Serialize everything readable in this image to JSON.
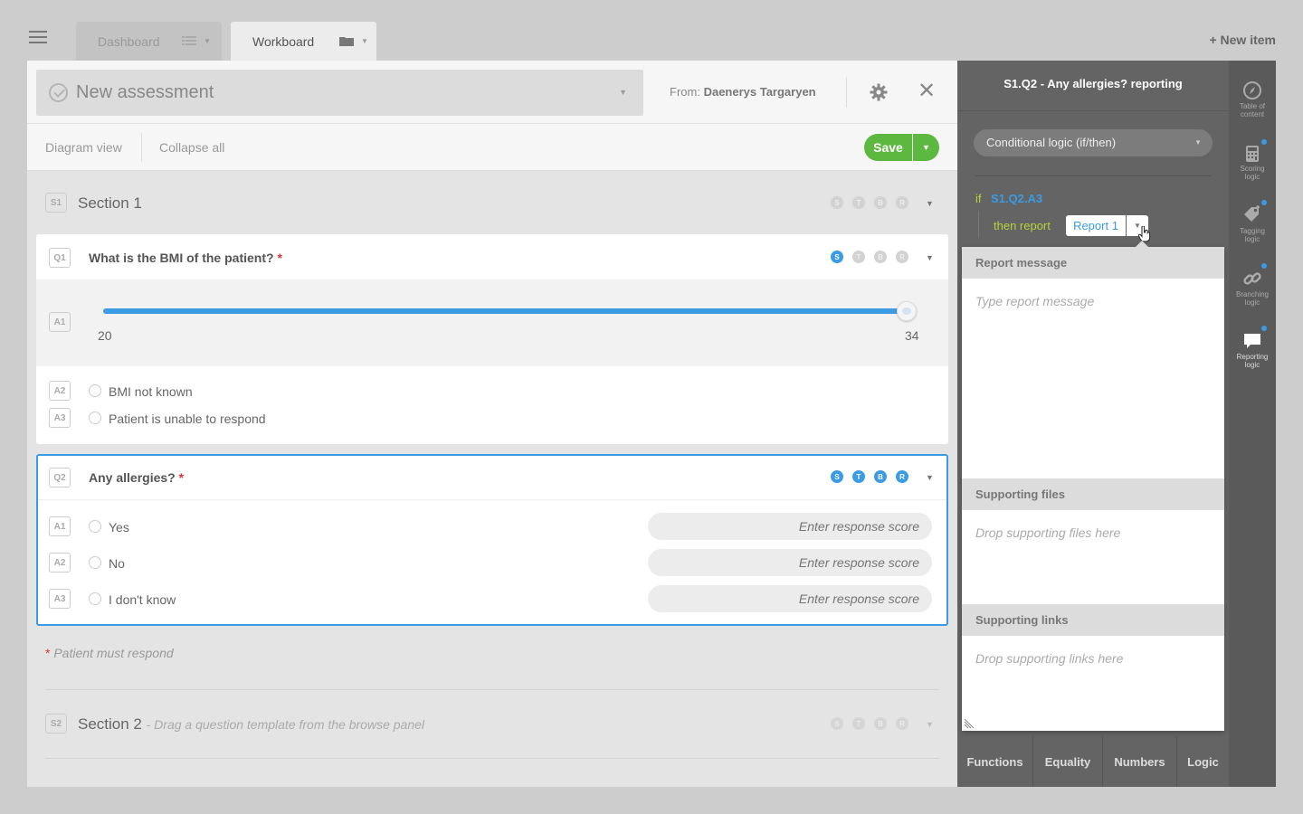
{
  "topbar": {
    "tabs": [
      {
        "label": "Dashboard"
      },
      {
        "label": "Workboard"
      }
    ],
    "new_item": "+ New item"
  },
  "header": {
    "title": "New assessment",
    "from_label": "From:",
    "from_name": "Daenerys Targaryen"
  },
  "toolbar": {
    "diagram_view": "Diagram view",
    "collapse_all": "Collapse all",
    "save": "Save"
  },
  "flags": [
    "S",
    "T",
    "B",
    "R"
  ],
  "section1": {
    "badge": "S1",
    "title": "Section 1"
  },
  "q1": {
    "badge": "Q1",
    "title": "What is the BMI of the patient?",
    "required_mark": "*",
    "slider": {
      "badge": "A1",
      "min_label": "20",
      "max_label": "34",
      "value_fraction": 1.0
    },
    "answers": [
      {
        "badge": "A2",
        "text": "BMI not known"
      },
      {
        "badge": "A3",
        "text": "Patient is unable to respond"
      }
    ]
  },
  "q2": {
    "badge": "Q2",
    "title": "Any allergies?",
    "required_mark": "*",
    "answers": [
      {
        "badge": "A1",
        "text": "Yes",
        "score_placeholder": "Enter response score"
      },
      {
        "badge": "A2",
        "text": "No",
        "score_placeholder": "Enter response score"
      },
      {
        "badge": "A3",
        "text": "I don't know",
        "score_placeholder": "Enter response score"
      }
    ]
  },
  "note": {
    "mark": "*",
    "text": "Patient must respond"
  },
  "section2": {
    "badge": "S2",
    "title": "Section 2",
    "subtitle": "- Drag a question template from the browse panel"
  },
  "logic_panel": {
    "title": "S1.Q2 - Any allergies? reporting",
    "logic_type": "Conditional logic (if/then)",
    "if_kw": "if",
    "condition_ref": "S1.Q2.A3",
    "then_kw": "then report",
    "report": "Report 1",
    "popup": {
      "report_message_header": "Report message",
      "report_message_placeholder": "Type report message",
      "files_header": "Supporting files",
      "files_placeholder": "Drop supporting files here",
      "links_header": "Supporting links",
      "links_placeholder": "Drop supporting links here"
    },
    "bottom_tabs": [
      "Functions",
      "Equality",
      "Numbers",
      "Logic"
    ]
  },
  "rail": [
    {
      "label1": "Table of",
      "label2": "content",
      "icon": "compass-icon"
    },
    {
      "label1": "Scoring",
      "label2": "logic",
      "icon": "calculator-icon"
    },
    {
      "label1": "Tagging",
      "label2": "logic",
      "icon": "tag-icon"
    },
    {
      "label1": "Branching",
      "label2": "logic",
      "icon": "link-icon"
    },
    {
      "label1": "Reporting",
      "label2": "logic",
      "icon": "speech-bubble-icon"
    }
  ],
  "colors": {
    "accent": "#3b9be3",
    "save": "#5cb83f",
    "keyword": "#b6d43a",
    "required": "#dd3333"
  }
}
